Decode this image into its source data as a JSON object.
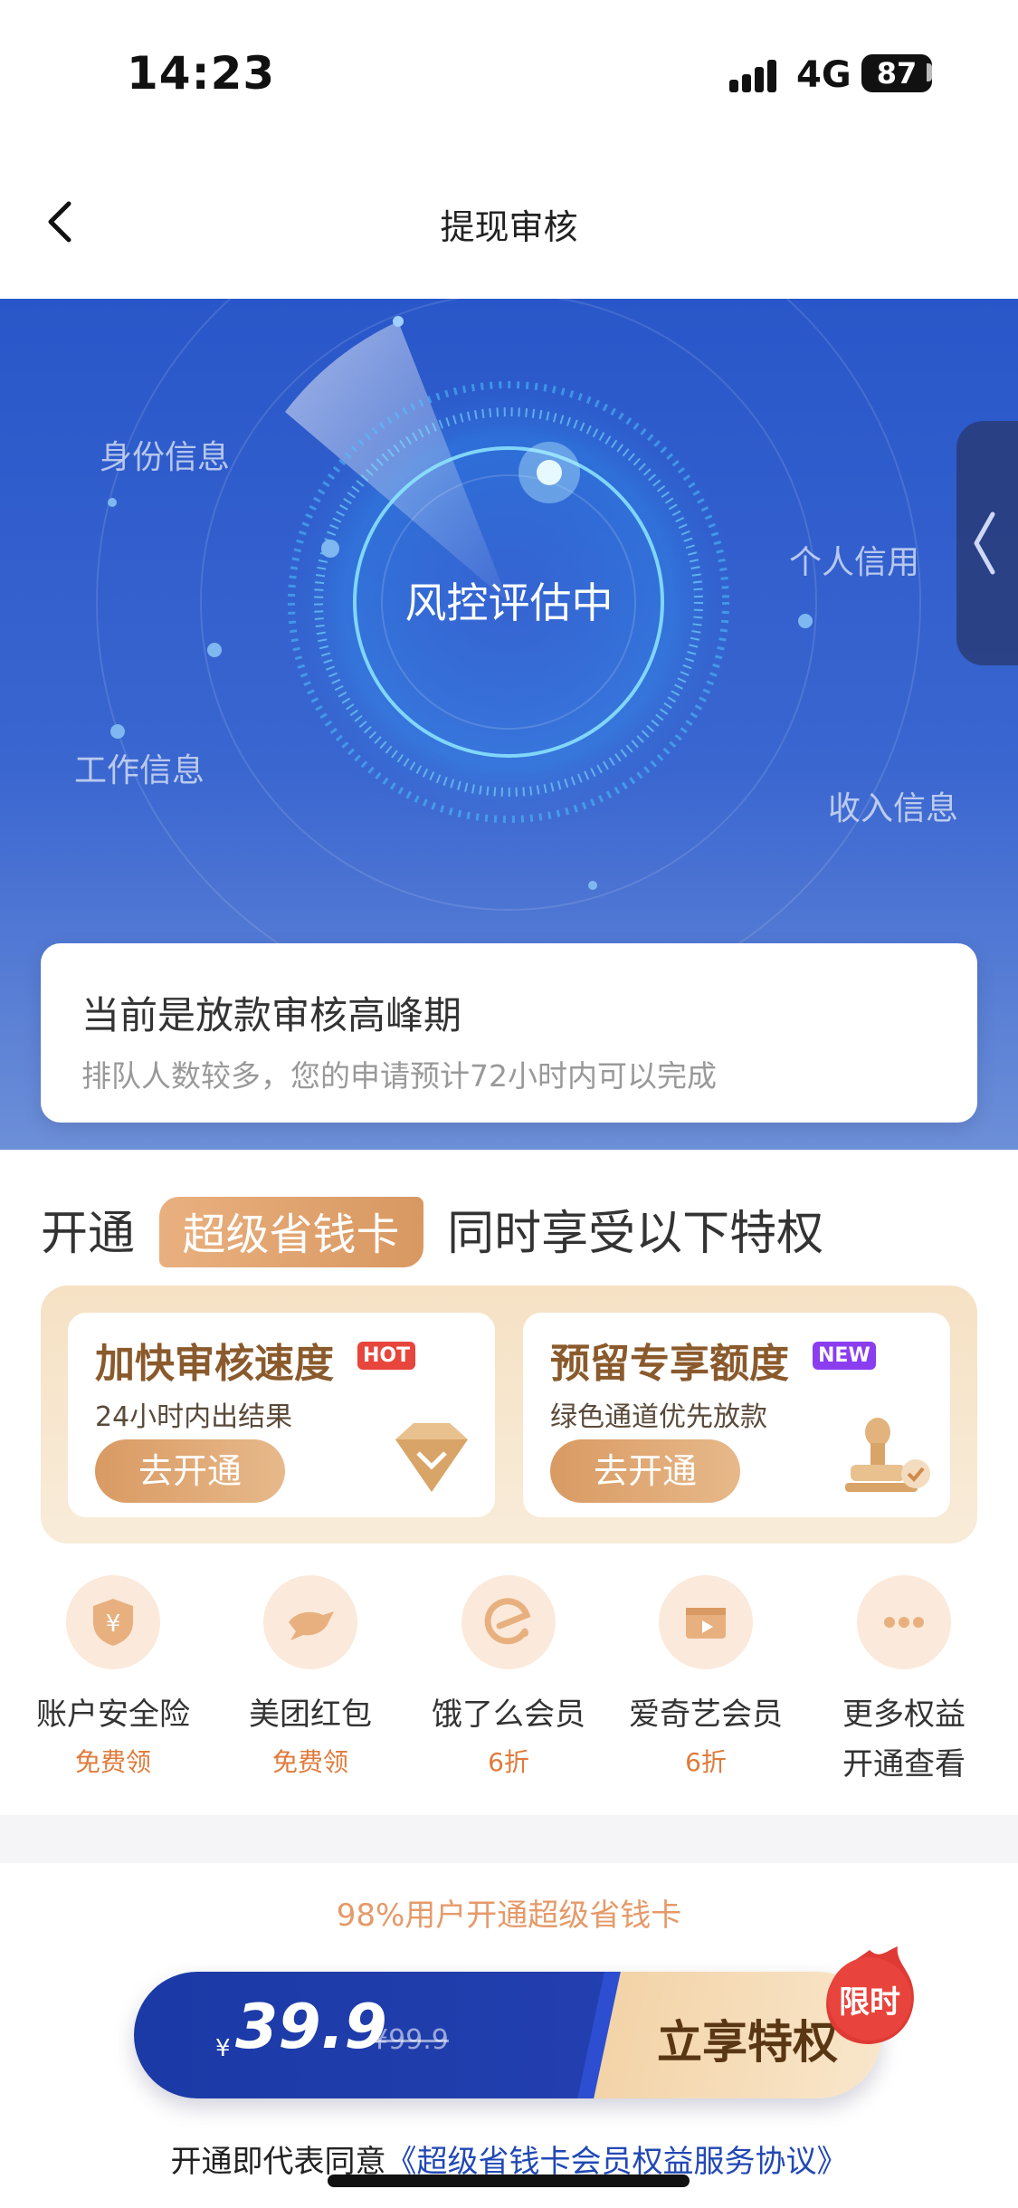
{
  "status_bar": {
    "time": "14:23",
    "network": "4G",
    "battery": "87"
  },
  "nav": {
    "title": "提现审核"
  },
  "hero": {
    "center_text": "风控评估中",
    "labels": {
      "identity": "身份信息",
      "credit": "个人信用",
      "work": "工作信息",
      "income": "收入信息"
    }
  },
  "notice": {
    "title": "当前是放款审核高峰期",
    "subtitle": "排队人数较多，您的申请预计72小时内可以完成"
  },
  "privileges": {
    "prefix": "开通",
    "badge": "超级省钱卡",
    "suffix": "同时享受以下特权",
    "cards": [
      {
        "title": "加快审核速度",
        "tag": "HOT",
        "tag_color": "#e8453c",
        "subtitle": "24小时内出结果",
        "button": "去开通",
        "icon": "diamond-icon"
      },
      {
        "title": "预留专享额度",
        "tag": "NEW",
        "tag_color": "#8b3df0",
        "subtitle": "绿色通道优先放款",
        "button": "去开通",
        "icon": "stamp-icon"
      }
    ],
    "benefits": [
      {
        "name": "账户安全险",
        "promo": "免费领",
        "icon": "shield-yen-icon"
      },
      {
        "name": "美团红包",
        "promo": "免费领",
        "icon": "kangaroo-icon"
      },
      {
        "name": "饿了么会员",
        "promo": "6折",
        "icon": "eleme-icon"
      },
      {
        "name": "爱奇艺会员",
        "promo": "6折",
        "icon": "video-icon"
      },
      {
        "name": "更多权益",
        "promo": "开通查看",
        "icon": "more-icon"
      }
    ]
  },
  "purchase": {
    "stat": "98%用户开通超级省钱卡",
    "currency": "¥",
    "price": "39.9",
    "original_price": "¥99.9",
    "cta": "立享特权",
    "limited": "限时",
    "agree_prefix": "开通即代表同意",
    "agree_link": "《超级省钱卡会员权益服务协议》"
  },
  "colors": {
    "brand_blue": "#2957c9",
    "gold": "#d89861",
    "accent_orange": "#e07a3a"
  }
}
